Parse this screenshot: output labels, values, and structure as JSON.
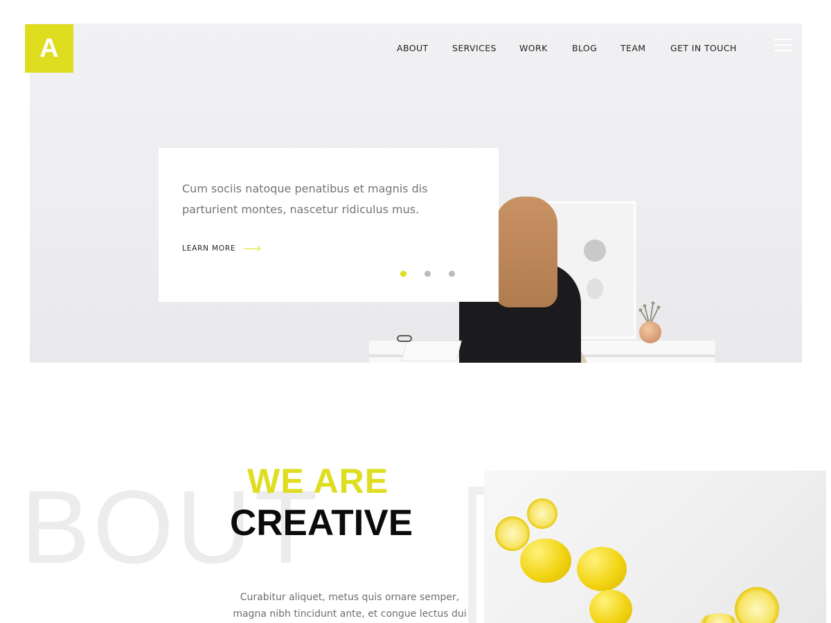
{
  "brand": {
    "logo_letter": "A",
    "accent_color": "#dedd1f"
  },
  "nav": {
    "items": [
      {
        "label": "ABOUT"
      },
      {
        "label": "SERVICES"
      },
      {
        "label": "WORK"
      },
      {
        "label": "BLOG"
      },
      {
        "label": "TEAM"
      },
      {
        "label": "GET IN TOUCH"
      }
    ],
    "menu_icon": "hamburger-icon"
  },
  "hero": {
    "text": "Cum sociis natoque penatibus et magnis dis parturient montes, nascetur ridiculus mus.",
    "learn_more": "LEARN MORE",
    "arrow_icon": "arrow-right-icon",
    "slides": {
      "count": 3,
      "active": 1
    }
  },
  "about": {
    "bg_word": "BOUT",
    "heading_line1": "WE ARE",
    "heading_line2": "CREATIVE",
    "text": "Curabitur aliquet, metus quis ornare semper, magna nibh tincidunt ante, et congue lectus dui"
  }
}
